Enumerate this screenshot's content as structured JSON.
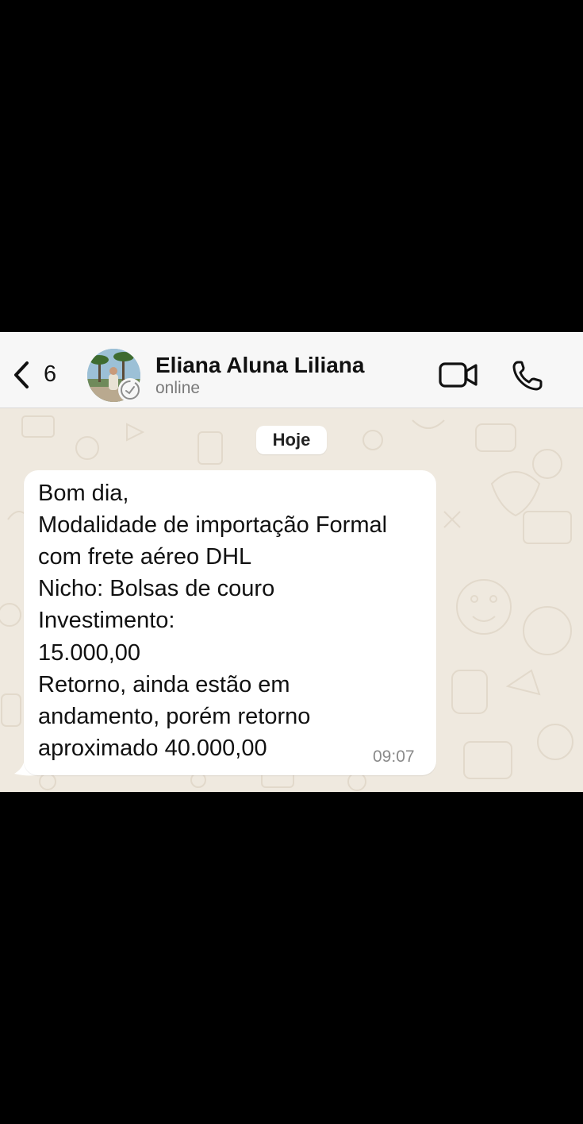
{
  "header": {
    "back_count": "6",
    "contact_name": "Eliana Aluna Liliana",
    "contact_status": "online",
    "icons": [
      "chevron-left-icon",
      "video-call-icon",
      "phone-icon"
    ]
  },
  "chat": {
    "date_label": "Hoje",
    "message": {
      "lines": [
        "Bom dia,",
        "Modalidade de importação Formal",
        "com frete aéreo DHL",
        "Nicho: Bolsas de couro",
        "Investimento:",
        "15.000,00",
        "Retorno, ainda estão em",
        "andamento,  porém retorno",
        "aproximado 40.000,00"
      ],
      "time": "09:07"
    }
  },
  "colors": {
    "header_bg": "#f7f7f7",
    "wallpaper_bg": "#efe9df",
    "bubble_bg": "#ffffff",
    "text": "#111111",
    "secondary_text": "#7a7a7a"
  }
}
